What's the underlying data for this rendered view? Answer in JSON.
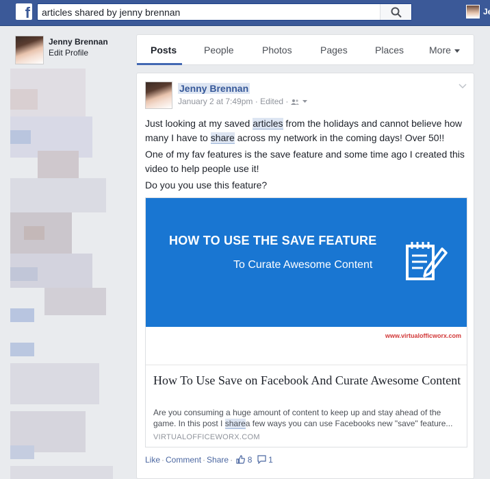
{
  "topbar": {
    "search_value": "articles shared by jenny brennan",
    "user_short": "Je"
  },
  "sidebar": {
    "profile_name": "Jenny Brennan",
    "edit_profile": "Edit Profile"
  },
  "tabs": [
    {
      "label": "Posts"
    },
    {
      "label": "People"
    },
    {
      "label": "Photos"
    },
    {
      "label": "Pages"
    },
    {
      "label": "Places"
    },
    {
      "label": "More"
    }
  ],
  "post": {
    "author": "Jenny Brennan",
    "meta": "January 2 at 7:49pm · Edited ·",
    "text1_a": "Just looking at my saved ",
    "text1_hl1": "articles",
    "text1_b": " from the holidays and cannot believe how many I have to ",
    "text1_hl2": "share",
    "text1_c": " across my network in the coming days! Over 50!!",
    "text2": "One of my fav features is the save feature and some time ago I created this video to help people use it!",
    "text3": "Do you you use this feature?",
    "banner_title": "HOW TO USE THE SAVE FEATURE",
    "banner_sub": "To Curate Awesome Content",
    "banner_url": "www.virtualofficworx.com",
    "link_title": "How To Use Save on Facebook And Curate Awesome Content",
    "link_desc_a": "Are you consuming a huge amount of content to keep up and stay ahead of the game. In this post I ",
    "link_desc_hl": "share",
    "link_desc_b": "a few ways you can use Facebooks new \"save\" feature...",
    "link_domain": "VIRTUALOFFICEWORX.COM",
    "like": "Like",
    "comment": "Comment",
    "share": "Share",
    "likes_count": "8",
    "comments_count": "1"
  },
  "colors": {
    "topbar": "#3b5998",
    "banner": "#1976d2",
    "link": "#365899"
  }
}
